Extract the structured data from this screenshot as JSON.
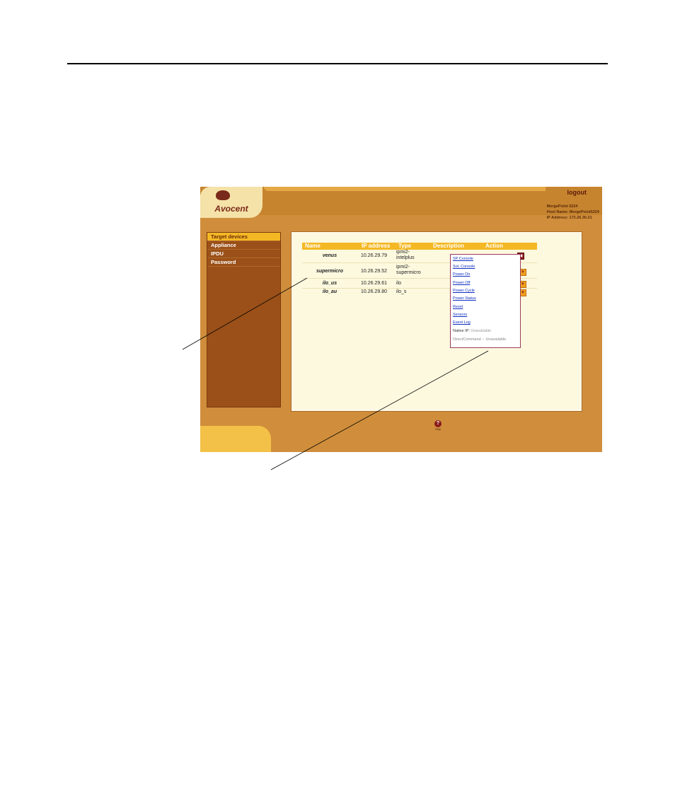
{
  "app": {
    "logo": {
      "text": "Avocent"
    },
    "logout_label": "logout",
    "host_info": {
      "line1": "MergePoint 5224",
      "line2": "Host Name: MergePoint5224",
      "line3": "IP Address: 172.26.30.21"
    },
    "sidebar": {
      "items": [
        {
          "label": "Target devices",
          "active": true
        },
        {
          "label": "Appliance",
          "active": false
        },
        {
          "label": "IPDU",
          "active": false
        },
        {
          "label": "Password",
          "active": false
        }
      ]
    },
    "table": {
      "headers": [
        "Name",
        "IP address",
        "Type",
        "Description",
        "Action"
      ],
      "rows": [
        {
          "name": "venus",
          "ip": "10.26.29.79",
          "type": "ipmi2-intelplus",
          "description": ""
        },
        {
          "name": "supermicro",
          "ip": "10.26.29.52",
          "type": "ipmi2-supermicro",
          "description": ""
        },
        {
          "name": "ilo_us",
          "ip": "10.26.29.61",
          "type": "ilo",
          "description": ""
        },
        {
          "name": "ilo_au",
          "ip": "10.26.29.80",
          "type": "ilo_s",
          "description": ""
        }
      ]
    },
    "action_menu": {
      "links": [
        "SP Console",
        "SoL Console",
        "Power On",
        "Power Off",
        "Power Cycle",
        "Power Status",
        "Reset",
        "Sensors",
        "Event Log"
      ],
      "native_ip_label": "Native IP:",
      "native_ip_value": "Unavailable",
      "direct_command": "DirectCommand -- Unavailable"
    },
    "help_label": "Help",
    "colors": {
      "frame": "#d08e3c",
      "sidebar": "#9a5018",
      "accent": "#f4b825",
      "content_bg": "#fdf9df",
      "link": "#1030c0"
    },
    "icons": {
      "logo": "avocent-logo-icon",
      "help": "help-icon",
      "action": "action-arrow-icon"
    }
  }
}
